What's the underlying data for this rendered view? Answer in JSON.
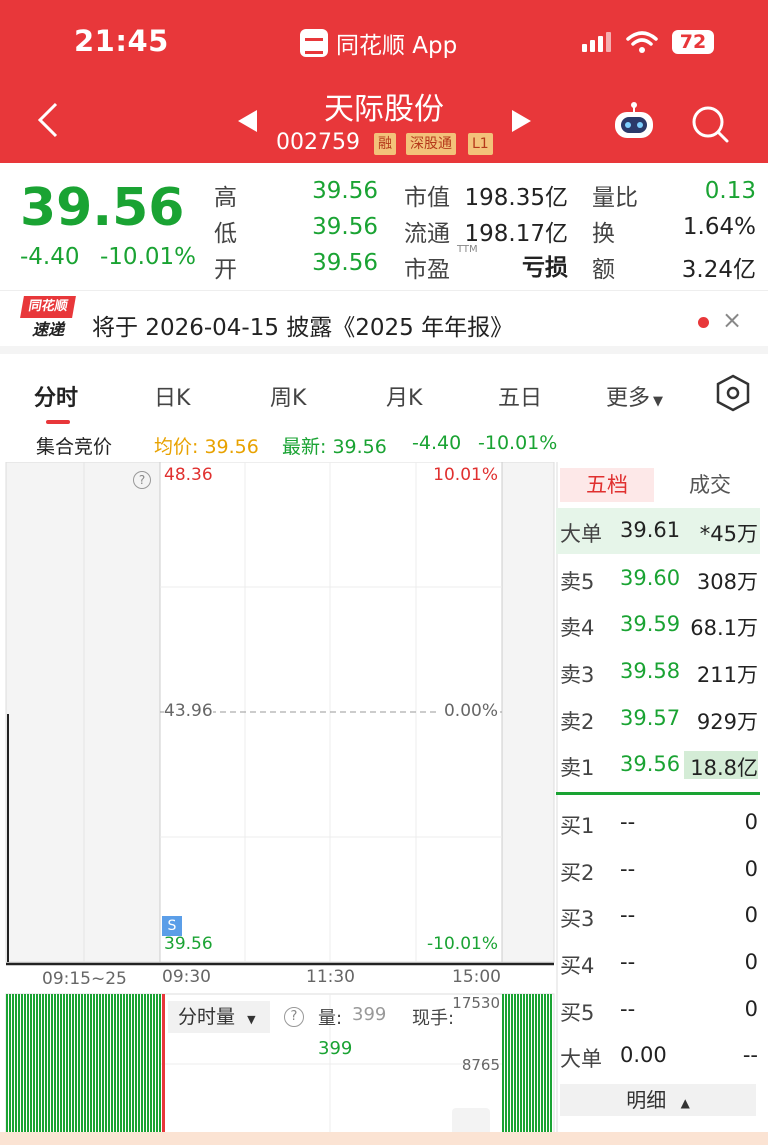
{
  "status_bar": {
    "time": "21:45",
    "app_name": "同花顺 App",
    "battery": "72"
  },
  "header": {
    "title": "天际股份",
    "code": "002759",
    "tags": [
      "融",
      "深股通",
      "L1"
    ]
  },
  "quote": {
    "price": "39.56",
    "change": "-4.40",
    "change_pct": "-10.01%",
    "rows": [
      {
        "l1": "高",
        "v1": "39.56",
        "l2": "市值",
        "v2": "198.35亿",
        "l3": "量比",
        "v3": "0.13"
      },
      {
        "l1": "低",
        "v1": "39.56",
        "l2": "流通",
        "v2": "198.17亿",
        "l3": "换",
        "v3": "1.64%"
      },
      {
        "l1": "开",
        "v1": "39.56",
        "l2": "市盈",
        "l2sup": "TTM",
        "v2": "亏损",
        "l3": "额",
        "v3": "3.24亿"
      }
    ]
  },
  "notice": {
    "logo_top": "同花顺",
    "logo_bottom": "速递",
    "text": "将于 2026-04-15 披露《2025 年年报》",
    "close": "×"
  },
  "tabs": [
    "分时",
    "日K",
    "周K",
    "月K",
    "五日",
    "更多"
  ],
  "info": {
    "label": "集合竞价",
    "avg": "均价: 39.56",
    "latest": "最新: 39.56",
    "change": "-4.40",
    "pct": "-10.01%"
  },
  "chart": {
    "top_price": "48.36",
    "top_pct": "10.01%",
    "mid_price": "43.96",
    "mid_pct": "0.00%",
    "bottom_price": "39.56",
    "bottom_pct": "-10.01%",
    "s_marker": "S",
    "help": "?",
    "time_labels": [
      "09:15~25",
      "09:30",
      "11:30",
      "15:00"
    ]
  },
  "volume": {
    "selector": "分时量",
    "help": "?",
    "qty_label": "量:",
    "qty_value": "399",
    "current_label": "现手:",
    "current_value": "399",
    "y_top": "17530",
    "y_mid": "8765"
  },
  "panel": {
    "tab_active": "五档",
    "tab_other": "成交",
    "big_sell": {
      "label": "大单",
      "price": "39.61",
      "vol": "*45万"
    },
    "sells": [
      {
        "label": "卖5",
        "price": "39.60",
        "vol": "308万"
      },
      {
        "label": "卖4",
        "price": "39.59",
        "vol": "68.1万"
      },
      {
        "label": "卖3",
        "price": "39.58",
        "vol": "211万"
      },
      {
        "label": "卖2",
        "price": "39.57",
        "vol": "929万"
      },
      {
        "label": "卖1",
        "price": "39.56",
        "vol": "18.8亿"
      }
    ],
    "buys": [
      {
        "label": "买1",
        "price": "--",
        "vol": "0"
      },
      {
        "label": "买2",
        "price": "--",
        "vol": "0"
      },
      {
        "label": "买3",
        "price": "--",
        "vol": "0"
      },
      {
        "label": "买4",
        "price": "--",
        "vol": "0"
      },
      {
        "label": "买5",
        "price": "--",
        "vol": "0"
      }
    ],
    "big_buy": {
      "label": "大单",
      "price": "0.00",
      "vol": "--"
    },
    "detail": "明细"
  },
  "colors": {
    "brand_red": "#e8373a",
    "down_green": "#1aa333"
  }
}
